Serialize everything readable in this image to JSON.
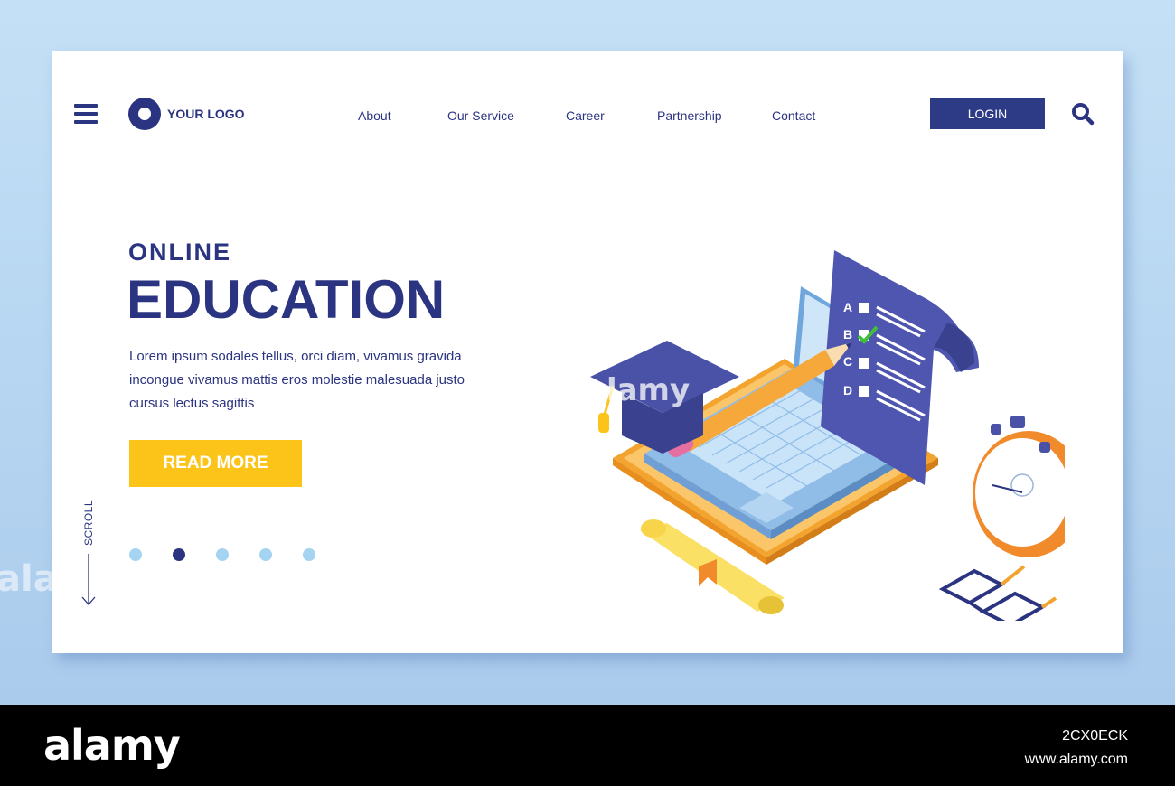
{
  "header": {
    "logo_text": "YOUR LOGO",
    "nav": [
      "About",
      "Our Service",
      "Career",
      "Partnership",
      "Contact"
    ],
    "login_label": "LOGIN"
  },
  "hero": {
    "subtitle": "ONLINE",
    "title": "EDUCATION",
    "description": "Lorem ipsum sodales tellus, orci diam, vivamus gravida incongue vivamus mattis eros molestie malesuada justo cursus lectus sagittis",
    "cta_label": "READ MORE",
    "scroll_label": "SCROLL"
  },
  "pagination": {
    "count": 5,
    "active_index": 1
  },
  "illustration": {
    "quiz_options": [
      "A",
      "B",
      "C",
      "D"
    ]
  },
  "watermark": {
    "text": "alamy",
    "image_id": "2CX0ECK",
    "site": "www.alamy.com"
  },
  "colors": {
    "primary": "#2b3480",
    "accent": "#fcc419",
    "background": "#c4e0f6",
    "dot_inactive": "#a4d4f2"
  }
}
